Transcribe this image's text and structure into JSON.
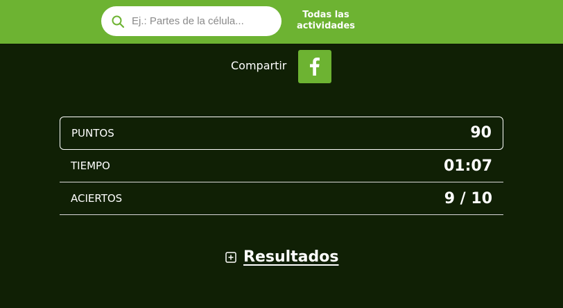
{
  "header": {
    "search": {
      "placeholder": "Ej.: Partes de la célula..."
    },
    "all_activities_line1": "Todas las",
    "all_activities_line2": "actividades"
  },
  "share": {
    "label": "Compartir",
    "network_icon": "facebook-icon"
  },
  "stats": [
    {
      "label": "PUNTOS",
      "value": "90"
    },
    {
      "label": "TIEMPO",
      "value": "01:07"
    },
    {
      "label": "ACIERTOS",
      "value": "9 / 10"
    }
  ],
  "results": {
    "label": "Resultados",
    "icon": "plus-square-icon"
  },
  "colors": {
    "brand_green": "#6db332",
    "background": "#102005",
    "text": "#ffffff"
  }
}
